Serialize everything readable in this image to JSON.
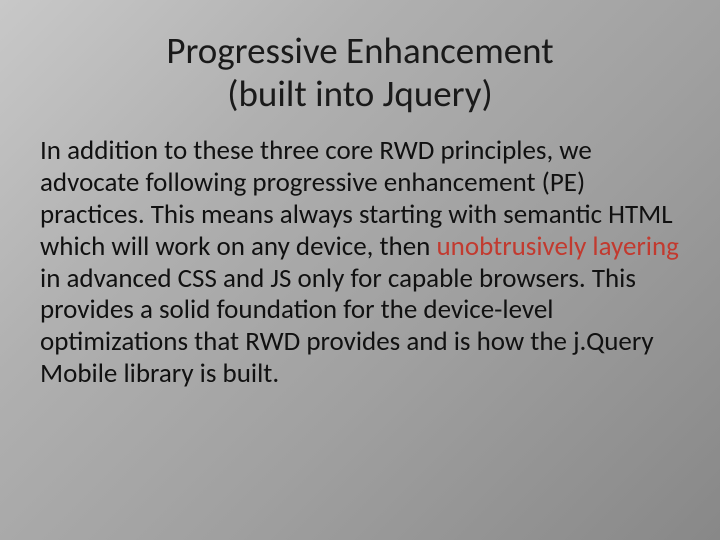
{
  "slide": {
    "title_line1": "Progressive Enhancement",
    "title_line2": "(built into Jquery)",
    "body_part1": "In addition to these three core RWD principles, we advocate following progressive enhancement (PE) practices. This means always starting with semantic HTML which will work on any device, then ",
    "body_highlight": "unobtrusively layering",
    "body_part2": " in advanced CSS and JS only for capable browsers. This provides a solid foundation for the device-level optimizations that RWD provides and is how the j.Query Mobile library is built.",
    "highlight_color": "#c23a2f"
  }
}
